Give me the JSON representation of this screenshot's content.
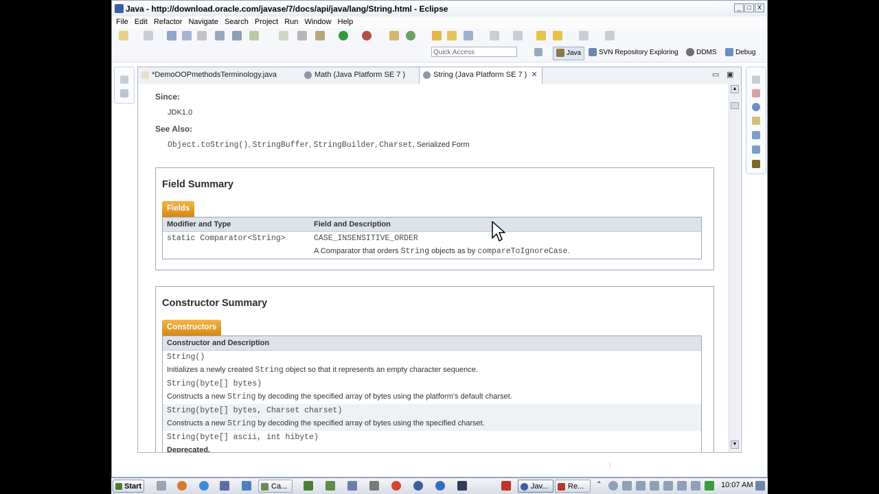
{
  "window": {
    "title": "Java - http://download.oracle.com/javase/7/docs/api/java/lang/String.html - Eclipse",
    "minimize": "_",
    "maximize": "□",
    "close": "X"
  },
  "menu": [
    "File",
    "Edit",
    "Refactor",
    "Navigate",
    "Search",
    "Project",
    "Run",
    "Window",
    "Help"
  ],
  "quick_access": {
    "placeholder": "Quick Access"
  },
  "perspectives": [
    "Java",
    "SVN Repository Exploring",
    "DDMS",
    "Debug"
  ],
  "editor_tabs": [
    {
      "label": "*DemoOOPmethodsTerminology.java"
    },
    {
      "label": "Math (Java Platform SE 7 )"
    },
    {
      "label": "String (Java Platform SE 7 )",
      "close": "✕"
    }
  ],
  "doc": {
    "since_label": "Since:",
    "since_value": "JDK1.0",
    "see_also_label": "See Also:",
    "see_also_items": [
      "Object.toString()",
      ",",
      "StringBuffer",
      ",",
      "StringBuilder",
      ",",
      "Charset",
      ",",
      "Serialized Form"
    ],
    "field_summary": {
      "title": "Field Summary",
      "caption": "Fields",
      "col1": "Modifier and Type",
      "col2": "Field and Description",
      "rows": [
        {
          "type": "static Comparator<String>",
          "name": "CASE_INSENSITIVE_ORDER",
          "desc_pre": "A Comparator that orders",
          "desc_code": "String",
          "desc_mid": "objects as by",
          "desc_code2": "compareToIgnoreCase",
          "desc_end": "."
        }
      ]
    },
    "constructor_summary": {
      "title": "Constructor Summary",
      "caption": "Constructors",
      "col1": "Constructor and Description",
      "rows": [
        {
          "sig_name": "String",
          "sig_args": "()",
          "desc_pre": "Initializes a newly created",
          "desc_code": "String",
          "desc_end": "object so that it represents an empty character sequence."
        },
        {
          "sig_name": "String",
          "sig_args": "(byte[] bytes)",
          "desc_pre": "Constructs a new",
          "desc_code": "String",
          "desc_end": "by decoding the specified array of bytes using the platform's default charset."
        },
        {
          "sig_name": "String",
          "sig_args": "(byte[] bytes, Charset charset)",
          "desc_pre": "Constructs a new",
          "desc_code": "String",
          "desc_end": "by decoding the specified array of bytes using the specified",
          "desc_link": "charset",
          "desc_dot": "."
        },
        {
          "sig_name": "String",
          "sig_args": "(byte[] ascii, int hibyte)",
          "desc_pre": "Deprecated.",
          "desc_code": "",
          "desc_end": ""
        }
      ]
    }
  },
  "taskbar": {
    "start": "Start",
    "tasks": [
      "Ca...",
      "Jav...",
      "Re..."
    ],
    "clock": "10:07 AM"
  },
  "colors": {
    "caption_orange": "#e0931a",
    "header_gray": "#dee3e9"
  }
}
